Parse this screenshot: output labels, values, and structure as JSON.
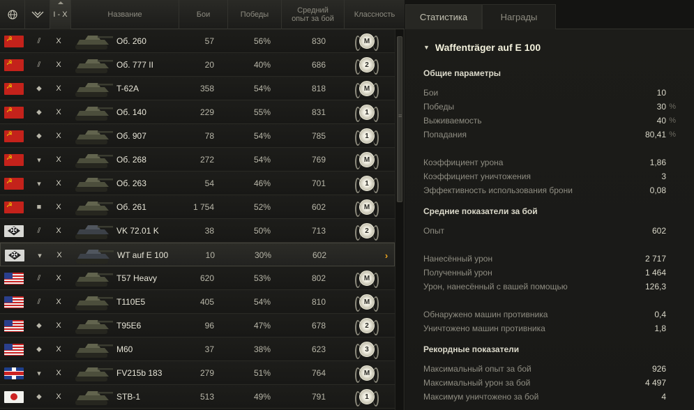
{
  "header": {
    "col_tier": "I - X",
    "col_name": "Название",
    "col_battles": "Бои",
    "col_wins": "Победы",
    "col_xp": "Средний опыт за бой",
    "col_mastery": "Классность",
    "icons": [
      "globe-icon",
      "vehicle-class-filter-icon"
    ]
  },
  "vehicles": [
    {
      "nation": "ussr",
      "class_icon": "ht-icon",
      "tier": "X",
      "name": "Об. 260",
      "battles": "57",
      "wins": "56%",
      "avg_xp": "830",
      "mastery": "M"
    },
    {
      "nation": "ussr",
      "class_icon": "ht-icon",
      "tier": "X",
      "name": "Об. 777 II",
      "battles": "20",
      "wins": "40%",
      "avg_xp": "686",
      "mastery": "2"
    },
    {
      "nation": "ussr",
      "class_icon": "mt-icon",
      "tier": "X",
      "name": "T-62A",
      "battles": "358",
      "wins": "54%",
      "avg_xp": "818",
      "mastery": "M"
    },
    {
      "nation": "ussr",
      "class_icon": "mt-icon",
      "tier": "X",
      "name": "Об. 140",
      "battles": "229",
      "wins": "55%",
      "avg_xp": "831",
      "mastery": "1"
    },
    {
      "nation": "ussr",
      "class_icon": "mt-icon",
      "tier": "X",
      "name": "Об. 907",
      "battles": "78",
      "wins": "54%",
      "avg_xp": "785",
      "mastery": "1"
    },
    {
      "nation": "ussr",
      "class_icon": "td-icon",
      "tier": "X",
      "name": "Об. 268",
      "battles": "272",
      "wins": "54%",
      "avg_xp": "769",
      "mastery": "M"
    },
    {
      "nation": "ussr",
      "class_icon": "td-icon",
      "tier": "X",
      "name": "Об. 263",
      "battles": "54",
      "wins": "46%",
      "avg_xp": "701",
      "mastery": "1"
    },
    {
      "nation": "ussr",
      "class_icon": "spg-icon",
      "tier": "X",
      "name": "Об. 261",
      "battles": "1 754",
      "wins": "52%",
      "avg_xp": "602",
      "mastery": "M"
    },
    {
      "nation": "germany",
      "class_icon": "ht-icon",
      "tier": "X",
      "name": "VK 72.01 K",
      "battles": "38",
      "wins": "50%",
      "avg_xp": "713",
      "mastery": "2"
    },
    {
      "nation": "germany",
      "class_icon": "td-icon",
      "tier": "X",
      "name": "WT auf E 100",
      "battles": "10",
      "wins": "30%",
      "avg_xp": "602",
      "mastery": "",
      "selected": true
    },
    {
      "nation": "usa",
      "class_icon": "ht-icon",
      "tier": "X",
      "name": "T57 Heavy",
      "battles": "620",
      "wins": "53%",
      "avg_xp": "802",
      "mastery": "M"
    },
    {
      "nation": "usa",
      "class_icon": "ht-icon",
      "tier": "X",
      "name": "T110E5",
      "battles": "405",
      "wins": "54%",
      "avg_xp": "810",
      "mastery": "M"
    },
    {
      "nation": "usa",
      "class_icon": "mt-icon",
      "tier": "X",
      "name": "T95E6",
      "battles": "96",
      "wins": "47%",
      "avg_xp": "678",
      "mastery": "2"
    },
    {
      "nation": "usa",
      "class_icon": "mt-icon",
      "tier": "X",
      "name": "M60",
      "battles": "37",
      "wins": "38%",
      "avg_xp": "623",
      "mastery": "3"
    },
    {
      "nation": "uk",
      "class_icon": "td-icon",
      "tier": "X",
      "name": "FV215b 183",
      "battles": "279",
      "wins": "51%",
      "avg_xp": "764",
      "mastery": "M"
    },
    {
      "nation": "japan",
      "class_icon": "mt-icon",
      "tier": "X",
      "name": "STB-1",
      "battles": "513",
      "wins": "49%",
      "avg_xp": "791",
      "mastery": "1"
    }
  ],
  "tabs": [
    {
      "label": "Статистика",
      "active": true
    },
    {
      "label": "Награды",
      "active": false
    }
  ],
  "detail": {
    "vehicle_title": "Waffenträger auf E 100",
    "general": {
      "title": "Общие параметры",
      "rows": [
        {
          "label": "Бои",
          "value": "10",
          "unit": ""
        },
        {
          "label": "Победы",
          "value": "30",
          "unit": "%"
        },
        {
          "label": "Выживаемость",
          "value": "40",
          "unit": "%"
        },
        {
          "label": "Попадания",
          "value": "80,41",
          "unit": "%"
        },
        {
          "label": "Коэффициент урона",
          "value": "1,86",
          "unit": ""
        },
        {
          "label": "Коэффициент уничтожения",
          "value": "3",
          "unit": ""
        },
        {
          "label": "Эффективность использования брони",
          "value": "0,08",
          "unit": ""
        }
      ]
    },
    "average": {
      "title": "Средние показатели за бой",
      "rows": [
        {
          "label": "Опыт",
          "value": "602",
          "unit": ""
        },
        {
          "label": "Нанесённый урон",
          "value": "2 717",
          "unit": ""
        },
        {
          "label": "Полученный урон",
          "value": "1 464",
          "unit": ""
        },
        {
          "label": "Урон, нанесённый с вашей помощью",
          "value": "126,3",
          "unit": ""
        },
        {
          "label": "Обнаружено машин противника",
          "value": "0,4",
          "unit": ""
        },
        {
          "label": "Уничтожено машин противника",
          "value": "1,8",
          "unit": ""
        }
      ]
    },
    "records": {
      "title": "Рекордные показатели",
      "rows": [
        {
          "label": "Максимальный опыт за бой",
          "value": "926",
          "unit": ""
        },
        {
          "label": "Максимальный урон за бой",
          "value": "4 497",
          "unit": ""
        },
        {
          "label": "Максимум уничтожено за бой",
          "value": "4",
          "unit": ""
        }
      ]
    }
  }
}
